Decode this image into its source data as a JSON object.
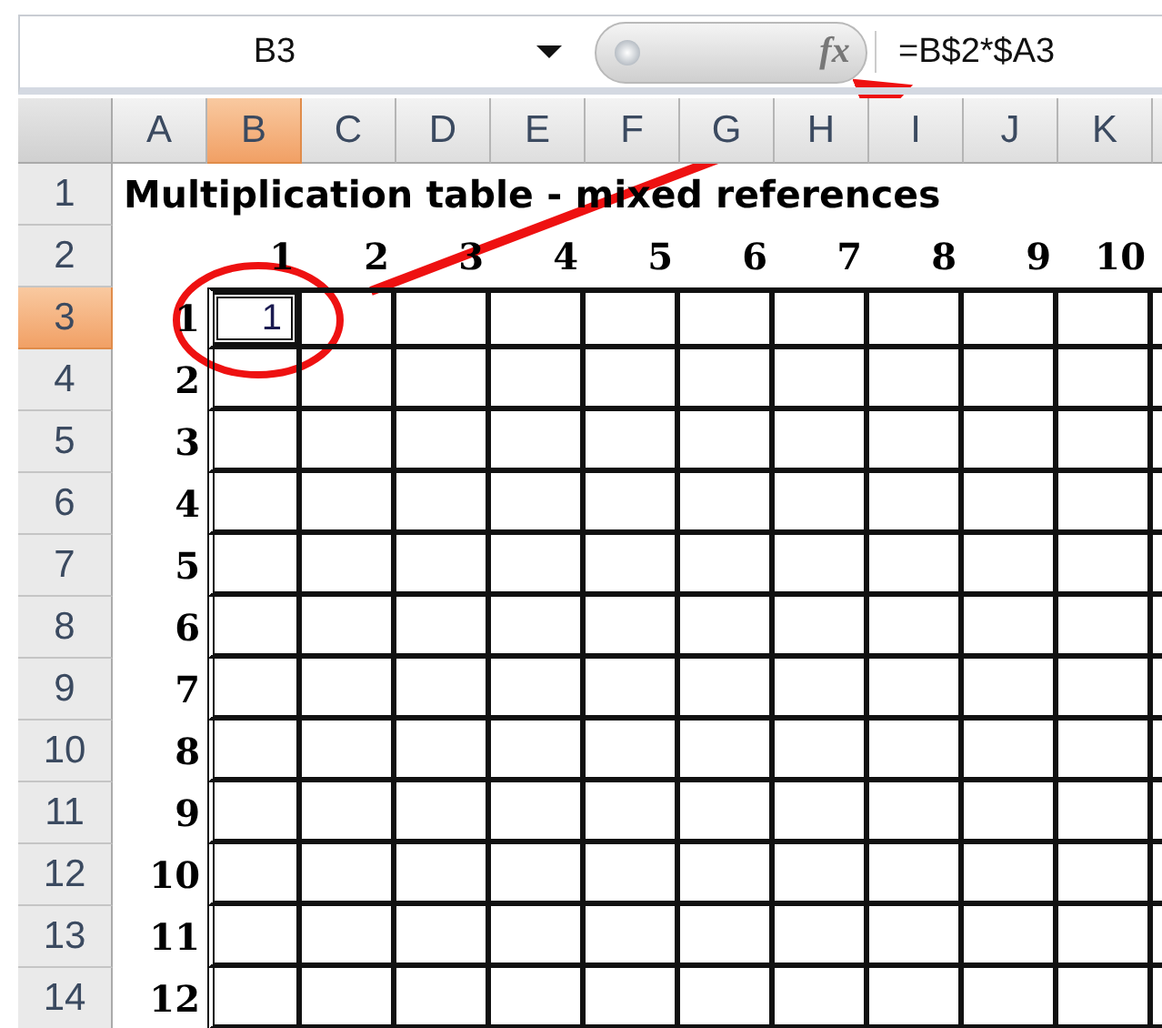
{
  "formula_bar": {
    "name_box": "B3",
    "function_label": "fx",
    "formula": "=B$2*$A3"
  },
  "columns": [
    {
      "label": "A",
      "selected": false
    },
    {
      "label": "B",
      "selected": true
    },
    {
      "label": "C",
      "selected": false
    },
    {
      "label": "D",
      "selected": false
    },
    {
      "label": "E",
      "selected": false
    },
    {
      "label": "F",
      "selected": false
    },
    {
      "label": "G",
      "selected": false
    },
    {
      "label": "H",
      "selected": false
    },
    {
      "label": "I",
      "selected": false
    },
    {
      "label": "J",
      "selected": false
    },
    {
      "label": "K",
      "selected": false
    }
  ],
  "rows": [
    {
      "label": "1",
      "selected": false,
      "kind": "title",
      "title": "Multiplication table - mixed references"
    },
    {
      "label": "2",
      "selected": false,
      "kind": "header",
      "cells": [
        {
          "text": "1"
        },
        {
          "text": "2"
        },
        {
          "text": "3"
        },
        {
          "text": "4"
        },
        {
          "text": "5"
        },
        {
          "text": "6"
        },
        {
          "text": "7"
        },
        {
          "text": "8"
        },
        {
          "text": "9"
        },
        {
          "text": "10"
        }
      ]
    },
    {
      "label": "3",
      "selected": true,
      "kind": "grid",
      "col_a": "1",
      "cells": [
        {
          "text": "1",
          "active": true
        }
      ]
    },
    {
      "label": "4",
      "selected": false,
      "kind": "grid",
      "col_a": "2"
    },
    {
      "label": "5",
      "selected": false,
      "kind": "grid",
      "col_a": "3"
    },
    {
      "label": "6",
      "selected": false,
      "kind": "grid",
      "col_a": "4"
    },
    {
      "label": "7",
      "selected": false,
      "kind": "grid",
      "col_a": "5"
    },
    {
      "label": "8",
      "selected": false,
      "kind": "grid",
      "col_a": "6"
    },
    {
      "label": "9",
      "selected": false,
      "kind": "grid",
      "col_a": "7"
    },
    {
      "label": "10",
      "selected": false,
      "kind": "grid",
      "col_a": "8"
    },
    {
      "label": "11",
      "selected": false,
      "kind": "grid",
      "col_a": "9"
    },
    {
      "label": "12",
      "selected": false,
      "kind": "grid",
      "col_a": "10"
    },
    {
      "label": "13",
      "selected": false,
      "kind": "grid",
      "col_a": "11"
    },
    {
      "label": "14",
      "selected": false,
      "kind": "grid",
      "col_a": "12"
    }
  ]
}
